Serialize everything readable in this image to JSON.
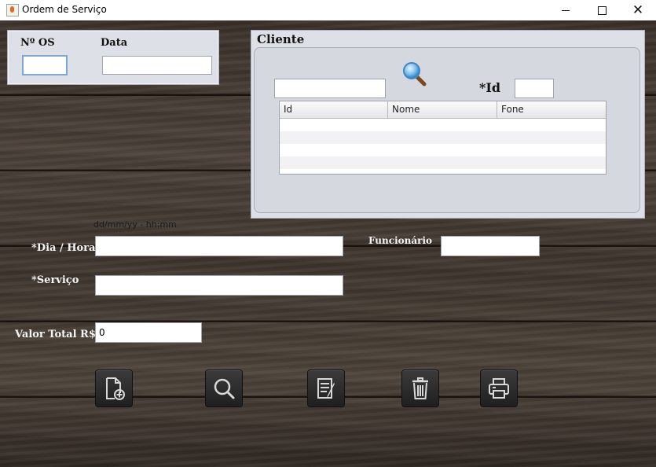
{
  "window": {
    "title": "Ordem de Serviço",
    "min_glyph": "",
    "max_glyph": "",
    "close_glyph": "✕"
  },
  "os_panel": {
    "os_label": "Nº OS",
    "os_value": "",
    "date_label": "Data",
    "date_value": ""
  },
  "client": {
    "title": "Cliente",
    "search_value": "",
    "id_label": "*Id",
    "id_value": "",
    "columns": [
      "Id",
      "Nome",
      "Fone"
    ],
    "rows": [
      [
        "",
        "",
        ""
      ],
      [
        "",
        "",
        ""
      ],
      [
        "",
        "",
        ""
      ],
      [
        "",
        "",
        ""
      ]
    ]
  },
  "form": {
    "date_hint": "dd/mm/yy - hh:mm",
    "datetime_label": "*Dia / Hora",
    "datetime_value": "",
    "employee_label": "Funcionário",
    "employee_value": "",
    "service_label": "*Serviço",
    "service_value": "",
    "total_label": "Valor Total R$",
    "total_value": "0"
  },
  "toolbar": {
    "buttons": [
      {
        "icon": "new-document-icon"
      },
      {
        "icon": "search-icon"
      },
      {
        "icon": "edit-document-icon"
      },
      {
        "icon": "trash-icon"
      },
      {
        "icon": "printer-icon"
      }
    ]
  },
  "colors": {
    "panel_bg": "#dde0e6",
    "wood": "#3f362e",
    "button_bg": "#2a2a2a"
  }
}
